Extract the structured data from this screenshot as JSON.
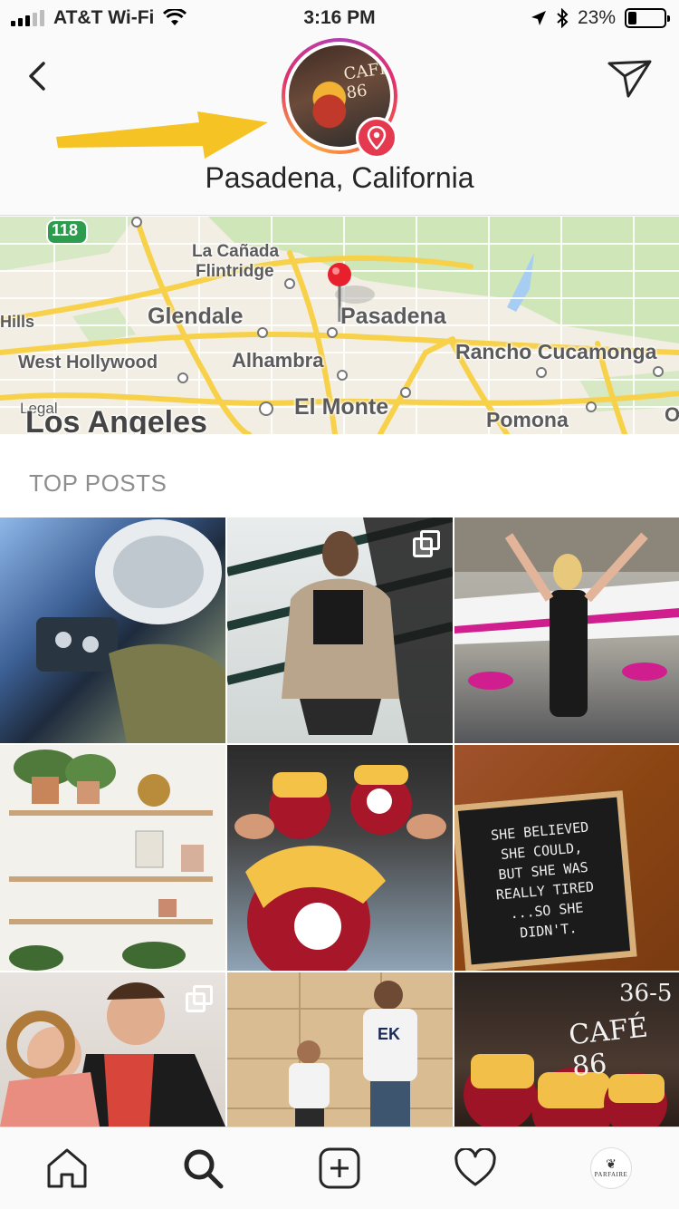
{
  "status_bar": {
    "carrier": "AT&T Wi-Fi",
    "time": "3:16 PM",
    "battery": "23%",
    "battery_level": 0.23
  },
  "header": {
    "title": "Pasadena, California",
    "avatar_sign": "CAFÉ 86"
  },
  "map": {
    "labels": [
      "La Cañada",
      "Flintridge",
      "Glendale",
      "Pasadena",
      "Rancho Cucamonga",
      "West Hollywood",
      "Alhambra",
      "El Monte",
      "Pomona",
      "Los Angeles",
      "Legal",
      "Hills",
      "118",
      "O"
    ]
  },
  "top_posts": {
    "title": "TOP POSTS",
    "posts": [
      {
        "subject": "pilot in jet cockpit"
      },
      {
        "subject": "woman in fur coat on stairs",
        "multiple": true
      },
      {
        "subject": "woman cheering by pink airplane"
      },
      {
        "subject": "plant shelves"
      },
      {
        "subject": "red velvet flan cupcakes"
      },
      {
        "subject": "letter board quote",
        "quote": [
          "SHE BELIEVED",
          "SHE COULD,",
          "BUT SHE WAS",
          "REALLY TIRED",
          "...SO SHE",
          "DIDN'T."
        ]
      },
      {
        "subject": "couple hugging",
        "multiple": true
      },
      {
        "subject": "two boys by wall",
        "hoodie_text": "EK"
      },
      {
        "subject": "cupcakes at cafe",
        "sign": [
          "36-5",
          "CAFÉ 86"
        ]
      }
    ]
  },
  "profile": {
    "brand": "PARFAIRE"
  },
  "colors": {
    "accent_pin": "#e53950",
    "arrow": "#f5c324",
    "secondary_text": "#8e8e8e"
  }
}
